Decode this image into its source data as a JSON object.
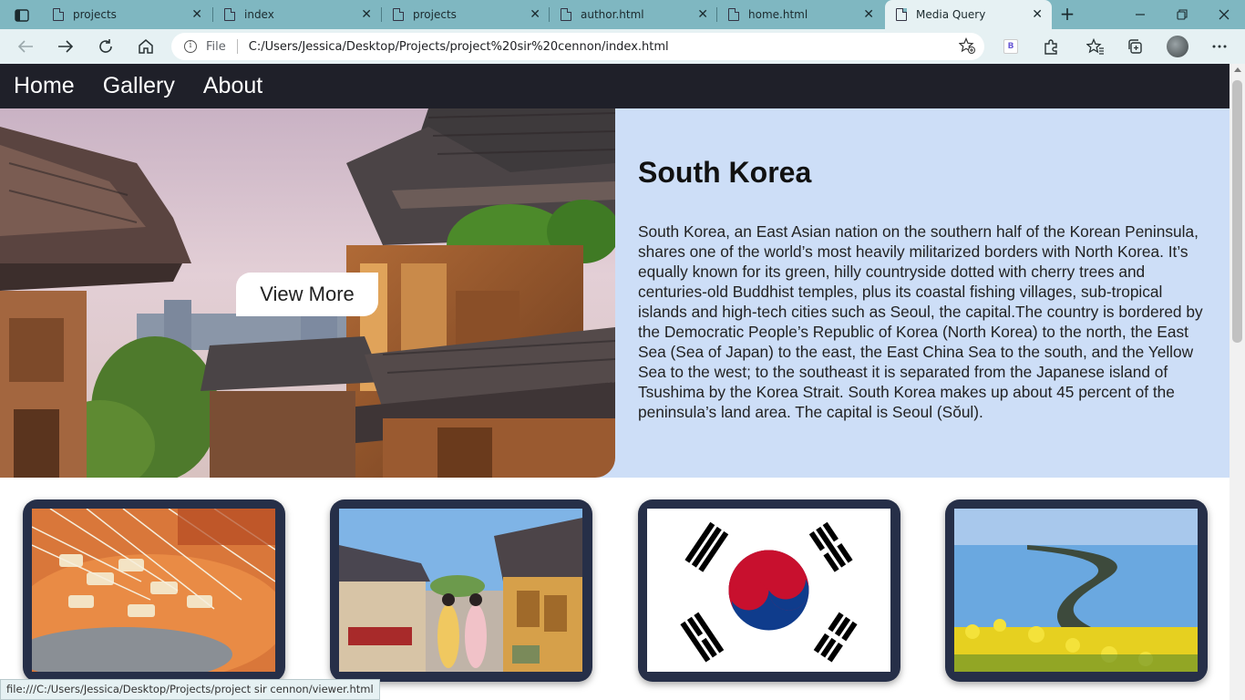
{
  "browser": {
    "tabs": [
      {
        "title": "projects",
        "active": false
      },
      {
        "title": "index",
        "active": false
      },
      {
        "title": "projects",
        "active": false
      },
      {
        "title": "author.html",
        "active": false
      },
      {
        "title": "home.html",
        "active": false
      },
      {
        "title": "Media Query",
        "active": true
      }
    ],
    "address": {
      "scheme_label": "File",
      "url": "C:/Users/Jessica/Desktop/Projects/project%20sir%20cennon/index.html"
    },
    "extension_badge": "B",
    "status_url": "file:///C:/Users/Jessica/Desktop/Projects/project sir cennon/viewer.html"
  },
  "site": {
    "nav": [
      "Home",
      "Gallery",
      "About"
    ],
    "hero": {
      "button": "View More",
      "title": "South Korea",
      "text": "South Korea, an East Asian nation on the southern half of the Korean Peninsula, shares one of the world’s most heavily militarized borders with North Korea. It’s equally known for its green, hilly countryside dotted with cherry trees and centuries-old Buddhist temples, plus its coastal fishing villages, sub-tropical islands and high-tech cities such as Seoul, the capital.The country is bordered by the Democratic People’s Republic of Korea (North Korea) to the north, the East Sea (Sea of Japan) to the east, the East China Sea to the south, and the Yellow Sea to the west; to the southeast it is separated from the Japanese island of Tsushima by the Korea Strait. South Korea makes up about 45 percent of the peninsula’s land area. The capital is Seoul (Sŏul)."
    },
    "gallery": [
      "fish-cake-skewers-photo",
      "hanok-street-photo",
      "korean-flag-image",
      "coastal-causeway-photo"
    ]
  }
}
